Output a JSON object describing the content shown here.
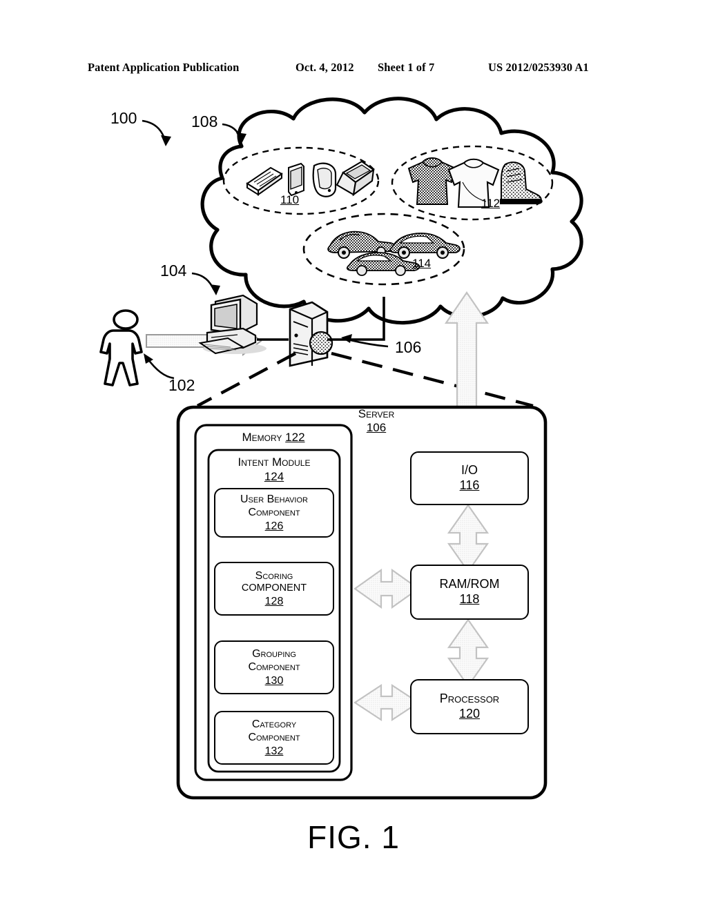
{
  "header": {
    "publication": "Patent Application Publication",
    "date": "Oct. 4, 2012",
    "sheet": "Sheet 1 of 7",
    "number": "US 2012/0253930 A1"
  },
  "figure": {
    "caption": "FIG. 1",
    "system_ref": "100"
  },
  "cloud": {
    "ref": "108",
    "name": "network-cloud",
    "clusters": [
      {
        "ref": "110",
        "name": "electronics-cluster",
        "items": [
          "calculator",
          "smartphone",
          "flip-phone",
          "laptop"
        ]
      },
      {
        "ref": "112",
        "name": "apparel-cluster",
        "items": [
          "sweater",
          "t-shirt",
          "boot"
        ]
      },
      {
        "ref": "114",
        "name": "vehicles-cluster",
        "items": [
          "sports-car",
          "sedan",
          "convertible"
        ]
      }
    ]
  },
  "actors": {
    "user": {
      "ref": "102",
      "name": "user-figure"
    },
    "client": {
      "ref": "104",
      "name": "client-computer"
    },
    "server_device": {
      "ref": "106",
      "name": "server-tower"
    }
  },
  "server": {
    "title": "Server",
    "ref": "106",
    "memory": {
      "title": "Memory",
      "ref": "122",
      "intent_module": {
        "title": "Intent Module",
        "ref": "124",
        "components": [
          {
            "line1": "User Behavior",
            "line2": "Component",
            "ref": "126",
            "name": "user-behavior-component"
          },
          {
            "line1": "Scoring",
            "line2": "COMPONENT",
            "ref": "128",
            "name": "scoring-component"
          },
          {
            "line1": "Grouping",
            "line2": "Component",
            "ref": "130",
            "name": "grouping-component"
          },
          {
            "line1": "Category",
            "line2": "Component",
            "ref": "132",
            "name": "category-component"
          }
        ]
      }
    },
    "hardware": [
      {
        "label": "I/O",
        "ref": "116",
        "name": "io-block"
      },
      {
        "label": "RAM/ROM",
        "ref": "118",
        "name": "ram-rom-block"
      },
      {
        "label": "Processor",
        "ref": "120",
        "name": "processor-block"
      }
    ]
  },
  "colors": {
    "ink": "#000000",
    "arrow_fill": "#f2f2f2",
    "arrow_stroke": "#b9b9b9",
    "shade": "#d9d9d9"
  }
}
